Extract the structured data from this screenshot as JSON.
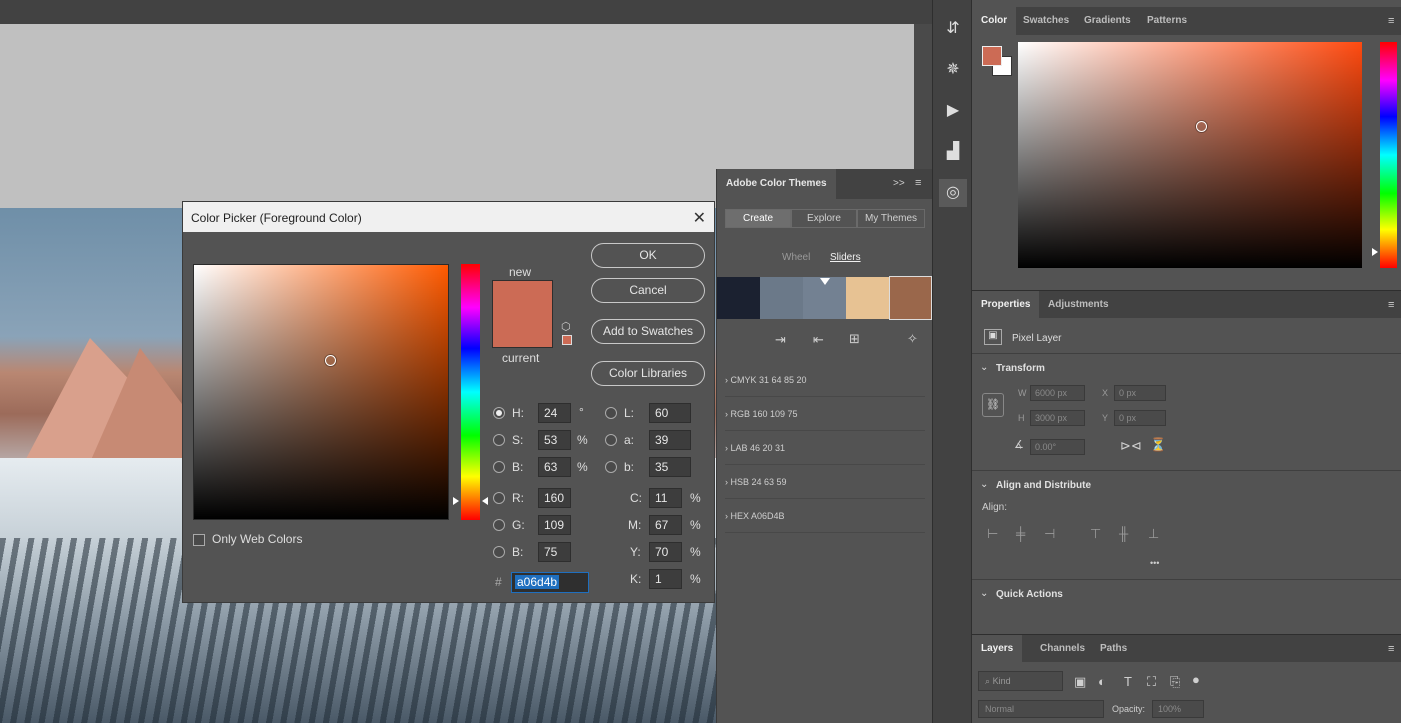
{
  "dialog": {
    "title": "Color Picker (Foreground Color)",
    "close_glyph": "✕",
    "new_label": "new",
    "current_label": "current",
    "ok_label": "OK",
    "cancel_label": "Cancel",
    "add_swatches_label": "Add to Swatches",
    "color_libraries_label": "Color Libraries",
    "only_web_colors_label": "Only Web Colors",
    "hsb": [
      {
        "label": "H:",
        "value": "24",
        "unit": "°"
      },
      {
        "label": "S:",
        "value": "53",
        "unit": "%"
      },
      {
        "label": "B:",
        "value": "63",
        "unit": "%"
      }
    ],
    "rgb": [
      {
        "label": "R:",
        "value": "160"
      },
      {
        "label": "G:",
        "value": "109"
      },
      {
        "label": "B:",
        "value": "75"
      }
    ],
    "lab": [
      {
        "label": "L:",
        "value": "60"
      },
      {
        "label": "a:",
        "value": "39"
      },
      {
        "label": "b:",
        "value": "35"
      }
    ],
    "cmyk": [
      {
        "label": "C:",
        "value": "11",
        "unit": "%"
      },
      {
        "label": "M:",
        "value": "67",
        "unit": "%"
      },
      {
        "label": "Y:",
        "value": "70",
        "unit": "%"
      },
      {
        "label": "K:",
        "value": "1",
        "unit": "%"
      }
    ],
    "hex_label": "#",
    "hex_value": "a06d4b",
    "new_color": "#cc6b55",
    "current_color": "#cc6b55"
  },
  "act_panel": {
    "title": "Adobe Color Themes",
    "collapse": ">>",
    "menu": "≡",
    "modes": [
      "Create",
      "Explore",
      "My Themes"
    ],
    "views": [
      "Wheel",
      "Sliders"
    ],
    "swatches": [
      "#1b2130",
      "#6b7989",
      "#738192",
      "#e7c293",
      "#9a674b"
    ],
    "rows": [
      "CMYK   31  64  85  20",
      "RGB   160  109  75",
      "LAB   46  20  31",
      "HSB   24  63  59",
      "HEX   A06D4B"
    ]
  },
  "right": {
    "color_tabs": [
      "Color",
      "Swatches",
      "Gradients",
      "Patterns"
    ],
    "fg_color": "#cc6b55",
    "bg_color": "#ffffff",
    "props_tabs": [
      "Properties",
      "Adjustments"
    ],
    "pixel_layer": "Pixel Layer",
    "transform": "Transform",
    "W_label": "W",
    "W_value": "6000 px",
    "H_label": "H",
    "H_value": "3000 px",
    "X_label": "X",
    "X_value": "0 px",
    "Y_label": "Y",
    "Y_value": "0 px",
    "angle_value": "0.00°",
    "align_distribute": "Align and Distribute",
    "align_label": "Align:",
    "more": "•••",
    "quick_actions": "Quick Actions",
    "layers_tabs": [
      "Layers",
      "Channels",
      "Paths"
    ],
    "kind_placeholder": "Kind",
    "blend_mode": "Normal",
    "opacity_label": "Opacity:",
    "opacity_value": "100%"
  }
}
